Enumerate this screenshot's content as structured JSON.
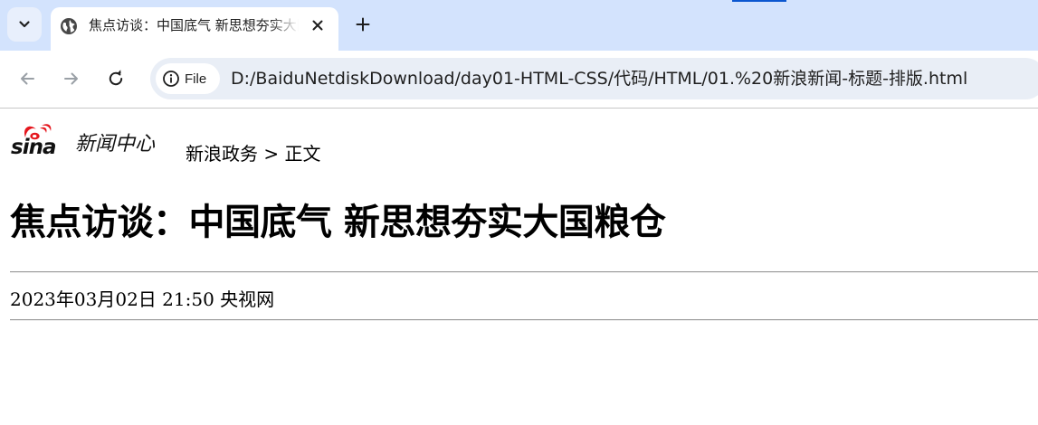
{
  "browser": {
    "tab": {
      "title": "焦点访谈：中国底气 新思想夯实大国粮仓",
      "favicon": "globe-icon"
    },
    "omnibox": {
      "chip_label": "File",
      "url": "D:/BaiduNetdiskDownload/day01-HTML-CSS/代码/HTML/01.%20新浪新闻-标题-排版.html"
    },
    "icons": {
      "tab_search": "chevron-down-icon",
      "close": "close-icon",
      "new_tab": "plus-icon",
      "back": "back-arrow-icon",
      "forward": "forward-arrow-icon",
      "reload": "reload-icon",
      "info": "info-icon"
    },
    "colors": {
      "tabstrip": "#d3e3fd",
      "omnibox": "#e9eef6",
      "accent": "#0b57d0"
    }
  },
  "page": {
    "logo": {
      "brand": "sina",
      "caption": "新闻中心",
      "accent_color": "#e5161d"
    },
    "breadcrumb": {
      "section": "新浪政务",
      "separator": ">",
      "current": "正文"
    },
    "title": "焦点访谈：中国底气 新思想夯实大国粮仓",
    "meta": {
      "date": "2023年03月02日 21:50",
      "source": "央视网"
    }
  }
}
